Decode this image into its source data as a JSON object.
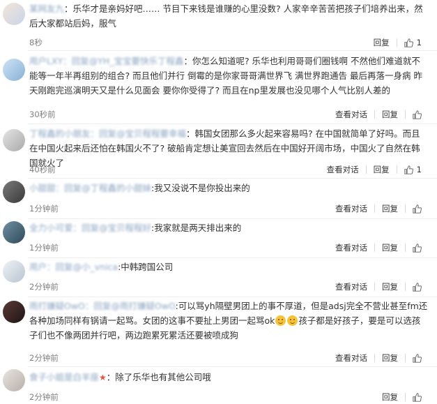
{
  "comments": [
    {
      "name": "某网友九",
      "text": "：乐华才是亲妈好吧…… 节目下来钱是谁赚的心里没数? 人家辛辛苦苦把孩子们培养出来，然后大家都站后妈，服气",
      "time": "8秒",
      "actions": [
        "回复"
      ],
      "likes": "1",
      "view_conversation": ""
    },
    {
      "name": "用户LXY：回复@YH_宝宝要快乐丁程鑫",
      "text": "：你怎么知道呢? 乐华也利用哥哥们圈钱啊 不然他们难道就不能等一年半再组别的组合? 而且他们并行 倒霉的是你家哥哥满世界飞 满世界跑通告 最后再落一身病 昨天刚跑完巡演明天又是什么见面会 要你你受得了? 而且在np里发展也没见哪个人气比别人差的",
      "time": "30秒前",
      "actions": [
        "查看对话",
        "回复"
      ],
      "likes": "",
      "view_conversation": "查看对话"
    },
    {
      "name": "丁程鑫的小朋友：回复@宝贝程程要幸福",
      "text": "：韩国女团那么多火起来容易吗? 在中国就简单了好吗。而且在中国火起来后还怕在韩国火不了? 破船肯定想让美宣回去然后在中国好开阔市场，中国火了自然在韩国就火了",
      "time": "40秒前",
      "actions": [
        "查看对话",
        "回复"
      ],
      "likes": "1",
      "view_conversation": "查看对话"
    },
    {
      "name": "小甜甜：回复@丁程鑫的小甜妹",
      "text": ":我又没说不是你投出来的",
      "time": "1分钟前",
      "actions": [
        "查看对话",
        "回复"
      ],
      "likes": "",
      "view_conversation": "查看对话"
    },
    {
      "name": "全力小可爱：回复@宝贝程程好",
      "text": ":我家就是两天排出来的",
      "time": "1分钟前",
      "actions": [
        "查看对话",
        "回复"
      ],
      "likes": "",
      "view_conversation": "查看对话"
    },
    {
      "name": "用户：回复@小_vnica",
      "text": ":中韩跨国公司",
      "time": "2分钟前",
      "actions": [
        "查看对话",
        "回复"
      ],
      "likes": "",
      "view_conversation": "查看对话"
    },
    {
      "name": "雨打嫌疑OwO：回复@雨打嫌疑OwO",
      "text_a": ":可以骂yh隔壁男团上的事不厚道，但是adsj完全不营业甚至fm还各种加场同样有锅请一起骂。女团的这事不要扯上男团一起骂ok",
      "text_b": "孩子都是好孩子，要是可以选孩子们也不像两团并行吧，两边跑累死累活还要被喷成狗",
      "time": "2分钟前",
      "actions": [
        "查看对话",
        "回复"
      ],
      "likes": "",
      "view_conversation": "查看对话"
    },
    {
      "name": "食子小姐是白羊座",
      "text": "：除了乐华也有其他公司哦",
      "time": "2分钟前",
      "actions": [
        "回复"
      ],
      "likes": "",
      "view_conversation": ""
    }
  ],
  "labels": {
    "reply": "回复",
    "view_conversation": "查看对话"
  },
  "colors": {
    "username": "#eb7350",
    "blurred_name": "#8aa3c0",
    "timestamp": "#808080"
  }
}
